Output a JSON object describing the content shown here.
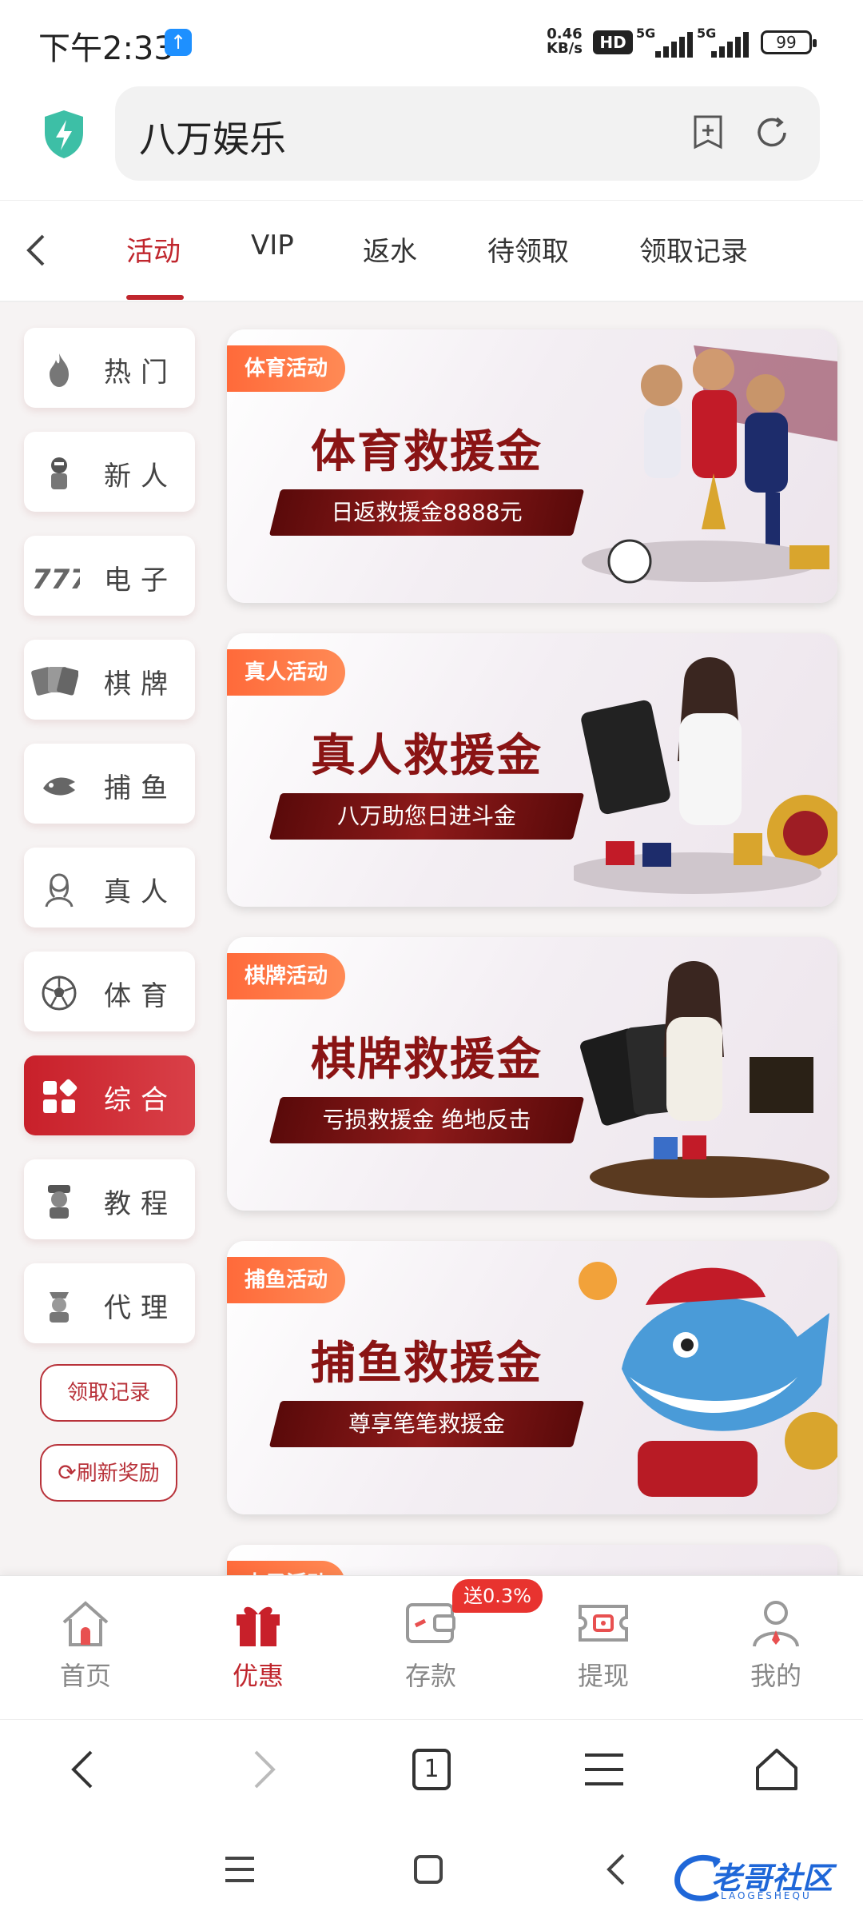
{
  "status_bar": {
    "time": "下午2:33",
    "net_speed_value": "0.46",
    "net_speed_unit": "KB/s",
    "hd_label": "HD",
    "signal1_label": "5G",
    "signal2_label": "5G",
    "battery": "99"
  },
  "browser": {
    "address_title": "八万娱乐"
  },
  "tabs": [
    {
      "label": "活动",
      "active": true
    },
    {
      "label": "VIP"
    },
    {
      "label": "返水"
    },
    {
      "label": "待领取"
    },
    {
      "label": "领取记录"
    }
  ],
  "sidebar": {
    "items": [
      {
        "label": "热门",
        "icon": "flame-icon"
      },
      {
        "label": "新人",
        "icon": "newbie-icon"
      },
      {
        "label": "电子",
        "icon": "slots-777-icon"
      },
      {
        "label": "棋牌",
        "icon": "cards-icon"
      },
      {
        "label": "捕鱼",
        "icon": "shark-icon"
      },
      {
        "label": "真人",
        "icon": "dealer-icon"
      },
      {
        "label": "体育",
        "icon": "soccer-ball-icon"
      },
      {
        "label": "综合",
        "icon": "grid-icon",
        "active": true
      },
      {
        "label": "教程",
        "icon": "tutor-icon"
      },
      {
        "label": "代理",
        "icon": "agent-icon"
      }
    ],
    "claim_record_label": "领取记录",
    "refresh_reward_label": "刷新奖励"
  },
  "banners": [
    {
      "tag": "体育活动",
      "headline": "体育救援金",
      "slogan": "日返救援金8888元"
    },
    {
      "tag": "真人活动",
      "headline": "真人救援金",
      "slogan": "八万助您日进斗金"
    },
    {
      "tag": "棋牌活动",
      "headline": "棋牌救援金",
      "slogan": "亏损救援金 绝地反击"
    },
    {
      "tag": "捕鱼活动",
      "headline": "捕鱼救援金",
      "slogan": "尊享笔笔救援金"
    },
    {
      "tag": "电子活动",
      "headline": "",
      "slogan": ""
    }
  ],
  "bottom_nav": [
    {
      "label": "首页",
      "icon": "home-icon"
    },
    {
      "label": "优惠",
      "icon": "gift-icon",
      "active": true
    },
    {
      "label": "存款",
      "icon": "wallet-icon"
    },
    {
      "label": "提现",
      "icon": "withdraw-ticket-icon"
    },
    {
      "label": "我的",
      "icon": "user-icon"
    }
  ],
  "deposit_badge": "送0.3%",
  "browser_nav": {
    "tab_count": "1"
  },
  "watermark": {
    "title": "老哥社区",
    "subtitle": "LAOGESHEQU"
  },
  "colors": {
    "accent": "#c0262d",
    "tag_orange": "#ff6a3a",
    "headline_red": "#8a1414"
  }
}
